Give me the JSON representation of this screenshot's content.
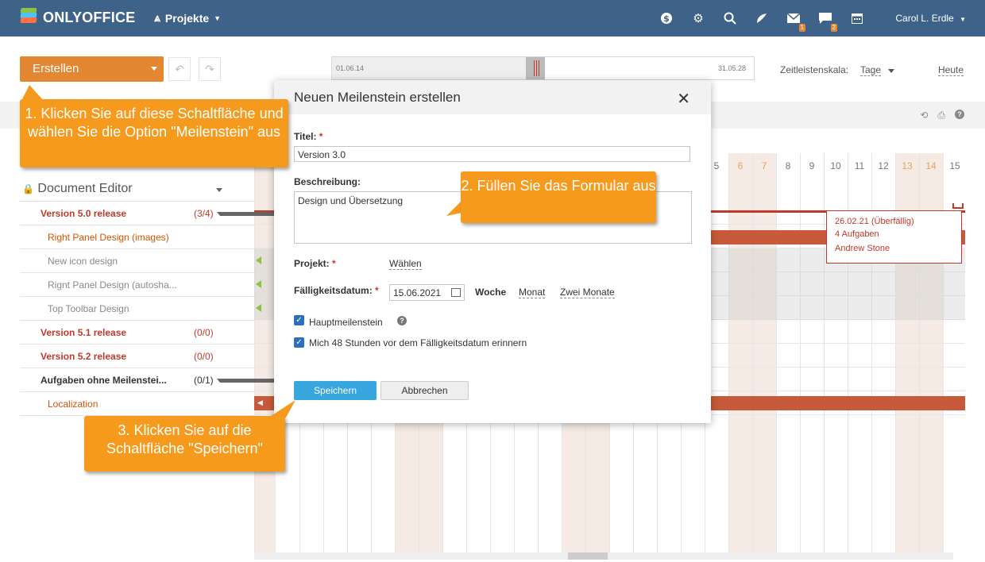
{
  "header": {
    "logo_text": "ONLYOFFICE",
    "module": "Projekte",
    "user": "Carol L. Erdle",
    "icons": [
      "dollar-icon",
      "gear-icon",
      "search-icon",
      "feed-icon",
      "mail-icon",
      "chat-icon",
      "calendar-icon"
    ],
    "mail_badge": "1",
    "chat_badge": "2"
  },
  "toolbar": {
    "create_label": "Erstellen",
    "timeline_start": "01.06.14",
    "timeline_end": "31.05.28",
    "scale_label": "Zeitleistenskala:",
    "scale_value": "Tage",
    "today_label": "Heute"
  },
  "gantt": {
    "project": "Document Editor",
    "rows": [
      {
        "label": "Version 5.0 release",
        "count": "(3/4)",
        "type": "milestone"
      },
      {
        "label": "Right Panel Design (images)",
        "type": "task-red"
      },
      {
        "label": "New icon design",
        "type": "task"
      },
      {
        "label": "Rignt Panel Design (autosha...",
        "type": "task"
      },
      {
        "label": "Top Toolbar Design",
        "type": "task"
      },
      {
        "label": "Version 5.1 release",
        "count": "(0/0)",
        "type": "milestone"
      },
      {
        "label": "Version 5.2 release",
        "count": "(0/0)",
        "type": "milestone"
      },
      {
        "label": "Aufgaben ohne Meilenstei...",
        "count": "(0/1)",
        "type": "ordinary"
      },
      {
        "label": "Localization",
        "type": "task-red"
      }
    ],
    "days": [
      "5",
      "6",
      "7",
      "8",
      "9",
      "10",
      "11",
      "12",
      "13",
      "14",
      "15"
    ],
    "weekend_days": [
      "6",
      "7",
      "13",
      "14"
    ],
    "tooltip": {
      "date": "26.02.21 (Überfällig)",
      "tasks": "4 Aufgaben",
      "person": "Andrew Stone"
    }
  },
  "modal": {
    "title": "Neuen Meilenstein erstellen",
    "title_label": "Titel:",
    "title_value": "Version 3.0",
    "desc_label": "Beschreibung:",
    "desc_value": "Design und Übersetzung",
    "project_label": "Projekt:",
    "project_link": "Wählen",
    "due_label": "Fälligkeitsdatum:",
    "due_value": "15.06.2021",
    "week": "Woche",
    "month": "Monat",
    "two_months": "Zwei Monate",
    "check1": "Hauptmeilenstein",
    "check2": "Mich 48 Stunden vor dem Fälligkeitsdatum erinnern",
    "save": "Speichern",
    "cancel": "Abbrechen",
    "required_mark": "*"
  },
  "callouts": {
    "c1": "1. Klicken Sie auf diese Schaltfläche und wählen Sie die Option \"Meilenstein\" aus",
    "c2": "2. Füllen Sie das Formular aus",
    "c3": "3. Klicken Sie auf die Schaltfläche \"Speichern\""
  },
  "colors": {
    "topbar": "#3f6289",
    "accent": "#e38733",
    "callout": "#f59a1c",
    "milestone": "#c0392b",
    "save": "#38a7e0"
  }
}
